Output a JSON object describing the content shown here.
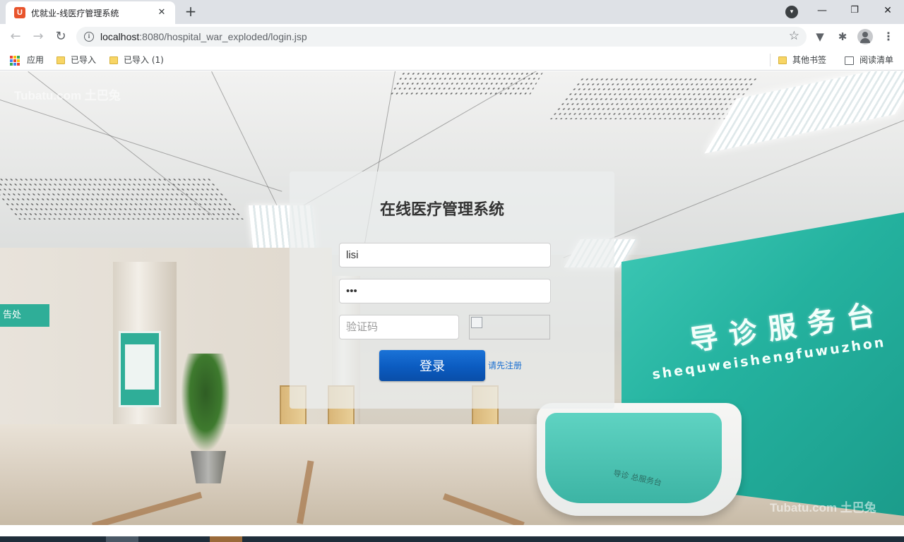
{
  "browser": {
    "tab": {
      "favicon_letter": "U",
      "title": "优就业-线医疗管理系统",
      "close_glyph": "✕"
    },
    "new_tab_glyph": "+",
    "window_controls": [
      "—",
      "❐",
      "✕"
    ],
    "address": {
      "host": "localhost",
      "rest": ":8080/hospital_war_exploded/login.jsp"
    },
    "bookmarks": {
      "apps_label": "应用",
      "items": [
        "已导入",
        "已导入 (1)"
      ],
      "other_label": "其他书签",
      "reading_list_label": "阅读清单"
    }
  },
  "page": {
    "title": "在线医疗管理系统",
    "username": {
      "value": "lisi"
    },
    "password": {
      "value": "•••"
    },
    "captcha": {
      "placeholder": "验证码"
    },
    "login_label": "登录",
    "register_label": "请先注册"
  },
  "background": {
    "sign_text": "导诊服务台",
    "sign_pinyin": "shequweishengfuwuzhon",
    "desk_text": "导诊 总服务台",
    "left_sign": "告处",
    "watermark_tl": "Tubatu.com 土巴兔",
    "watermark_br": "Tubatu.com 土巴兔"
  },
  "colors": {
    "accent": "#0b5bc0",
    "link": "#1a6fd1",
    "favicon": "#e8542c"
  }
}
